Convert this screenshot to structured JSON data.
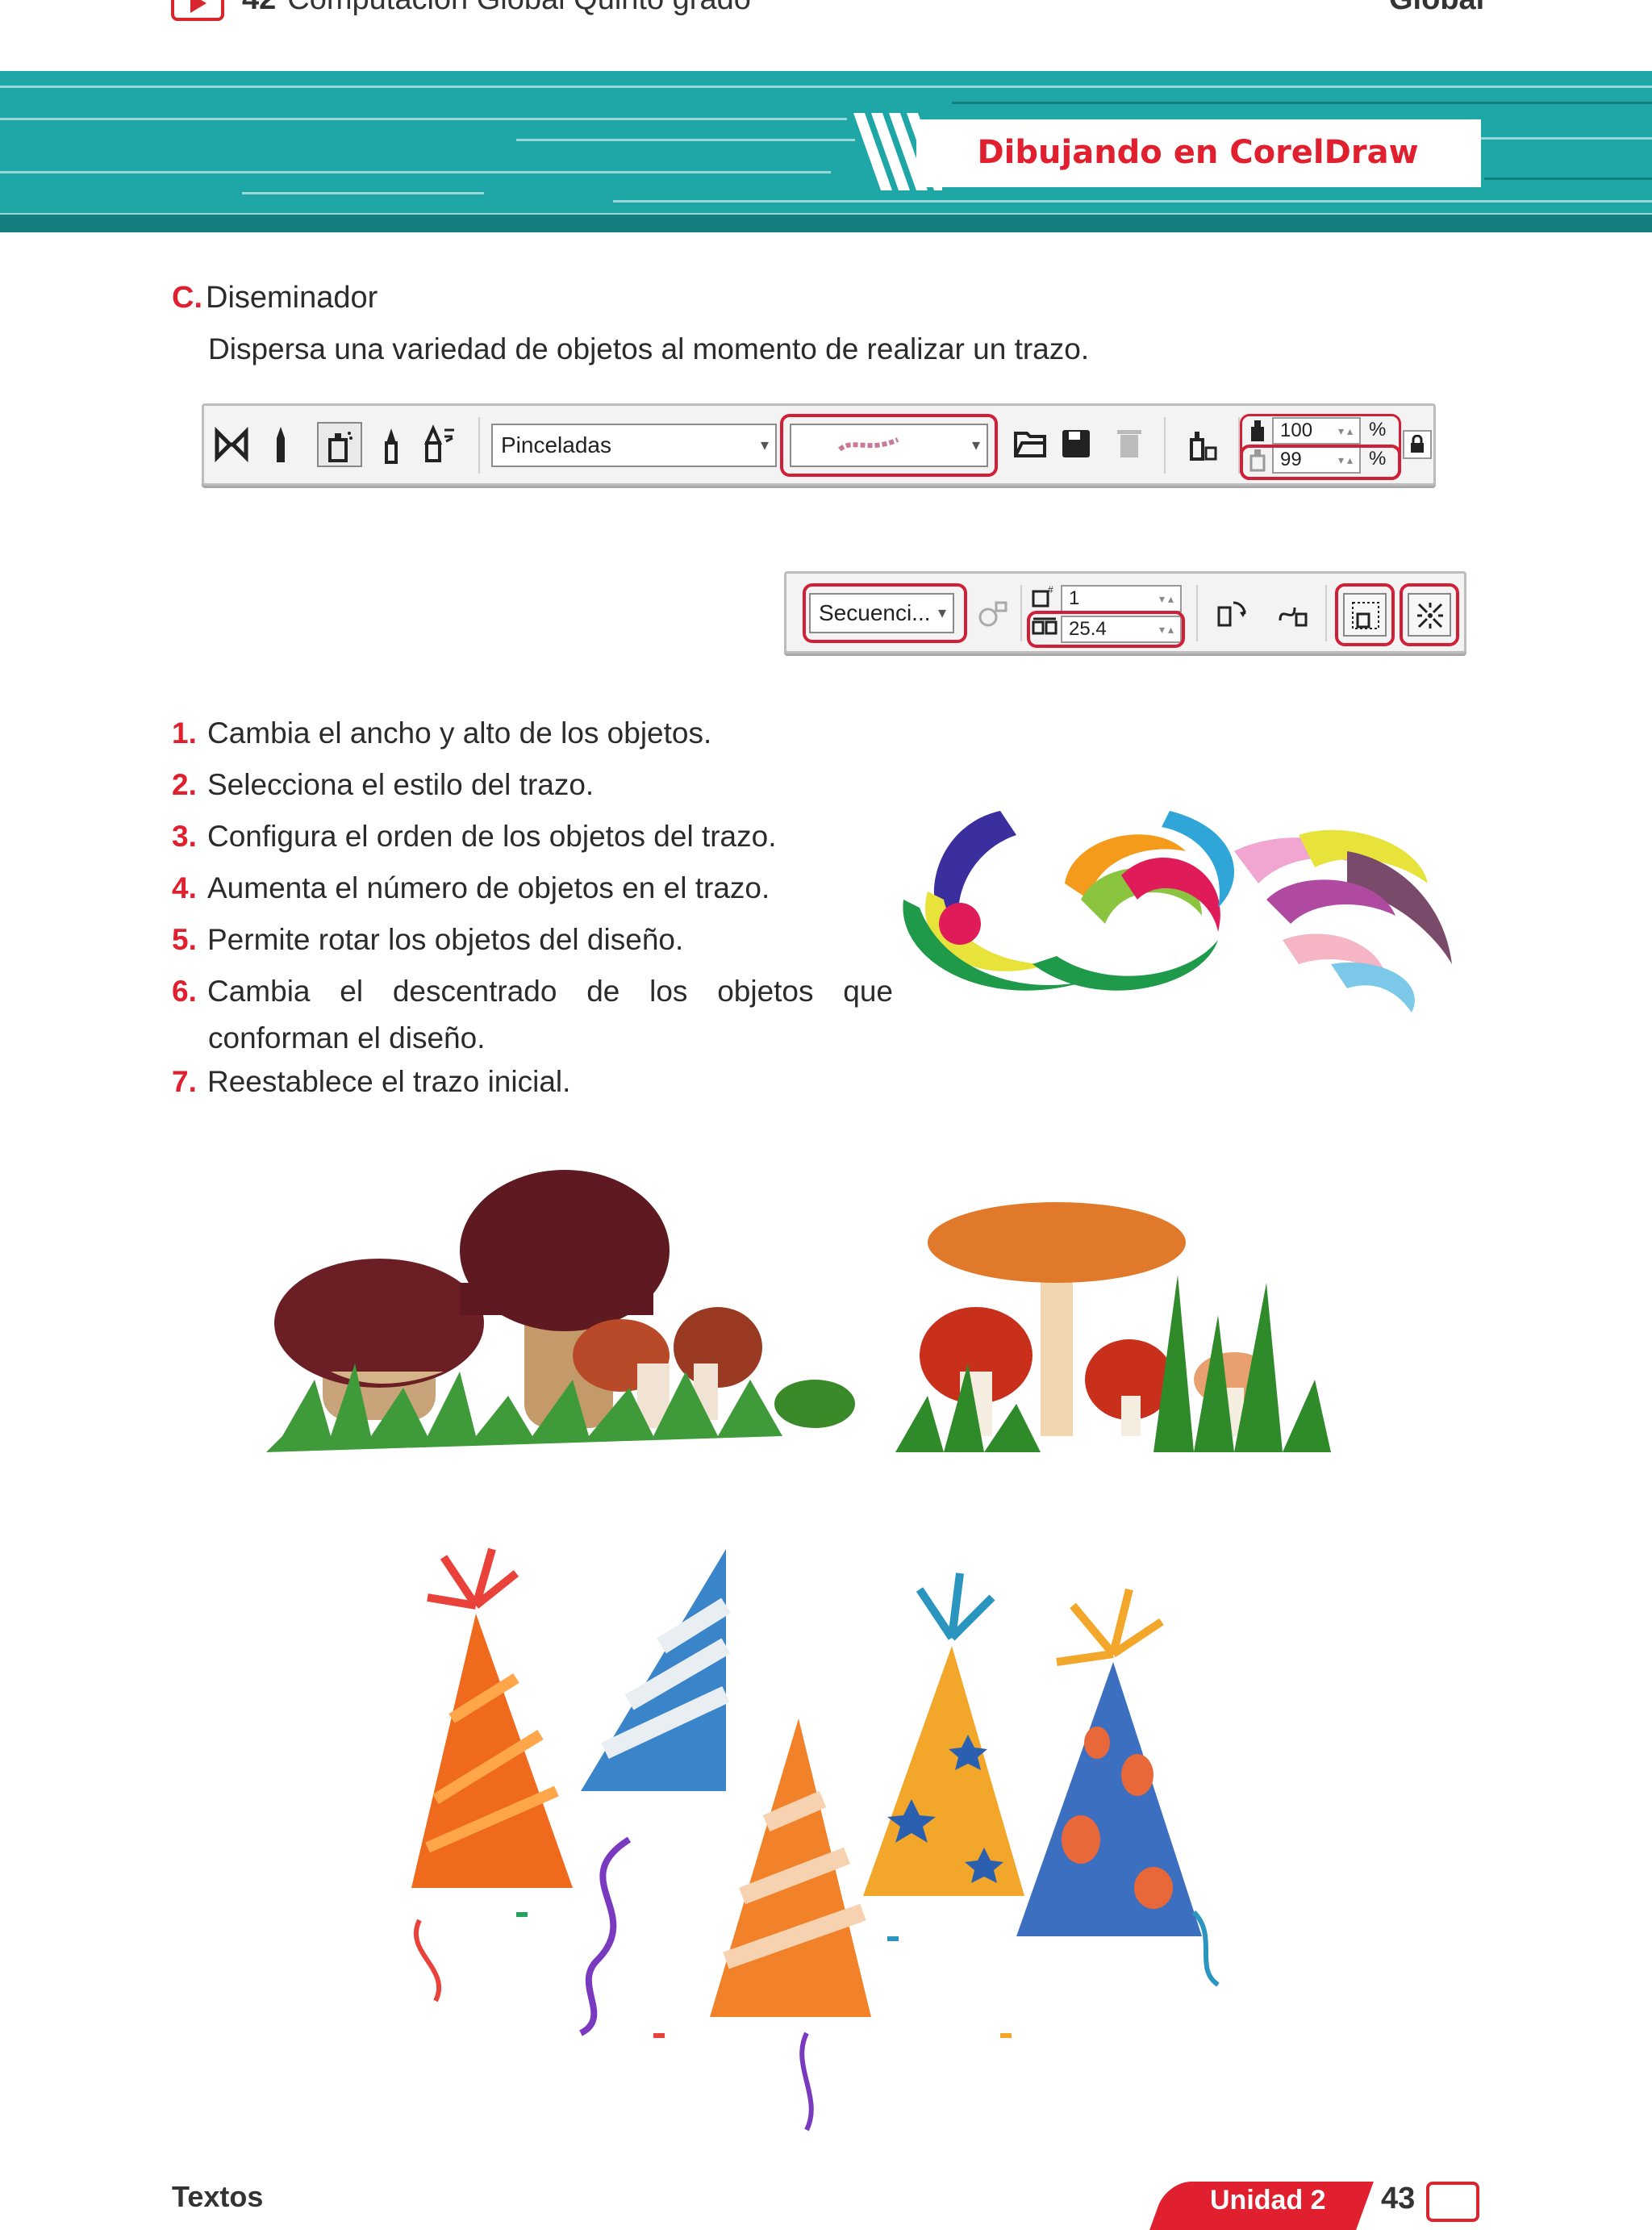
{
  "header": {
    "page_number": "42",
    "book_title": "Computación Global Quinto grado",
    "right_text": "Global"
  },
  "banner": {
    "title": "Dibujando en CorelDraw"
  },
  "section": {
    "label": "C.",
    "title": "Diseminador",
    "description": "Dispersa una variedad de objetos al momento de realizar un trazo."
  },
  "toolbar1": {
    "category_value": "Pinceladas",
    "size_value": "100",
    "size2_value": "99",
    "percent": "%"
  },
  "toolbar2": {
    "order_value": "Secuenci...",
    "count_value": "1",
    "spacing_value": "25.4"
  },
  "list": [
    {
      "n": "1.",
      "text": "Cambia el ancho y alto de los objetos."
    },
    {
      "n": "2.",
      "text": "Selecciona el estilo del trazo."
    },
    {
      "n": "3.",
      "text": "Configura el orden de los objetos del trazo."
    },
    {
      "n": "4.",
      "text": "Aumenta el número de objetos en el trazo."
    },
    {
      "n": "5.",
      "text": "Permite rotar los objetos del diseño."
    },
    {
      "n": "6.",
      "text_words": [
        "Cambia",
        "el",
        "descentrado",
        "de",
        "los",
        "objetos",
        "que"
      ],
      "text_cont": "conforman el diseño."
    },
    {
      "n": "7.",
      "text": "Reestablece el trazo inicial."
    }
  ],
  "footer": {
    "left_text": "Textos",
    "unit_label": "Unidad 2",
    "page_number": "43"
  },
  "colors": {
    "accent_red": "#e0202e",
    "banner_teal": "#1fa6a6",
    "highlight_red": "#d01f36"
  }
}
